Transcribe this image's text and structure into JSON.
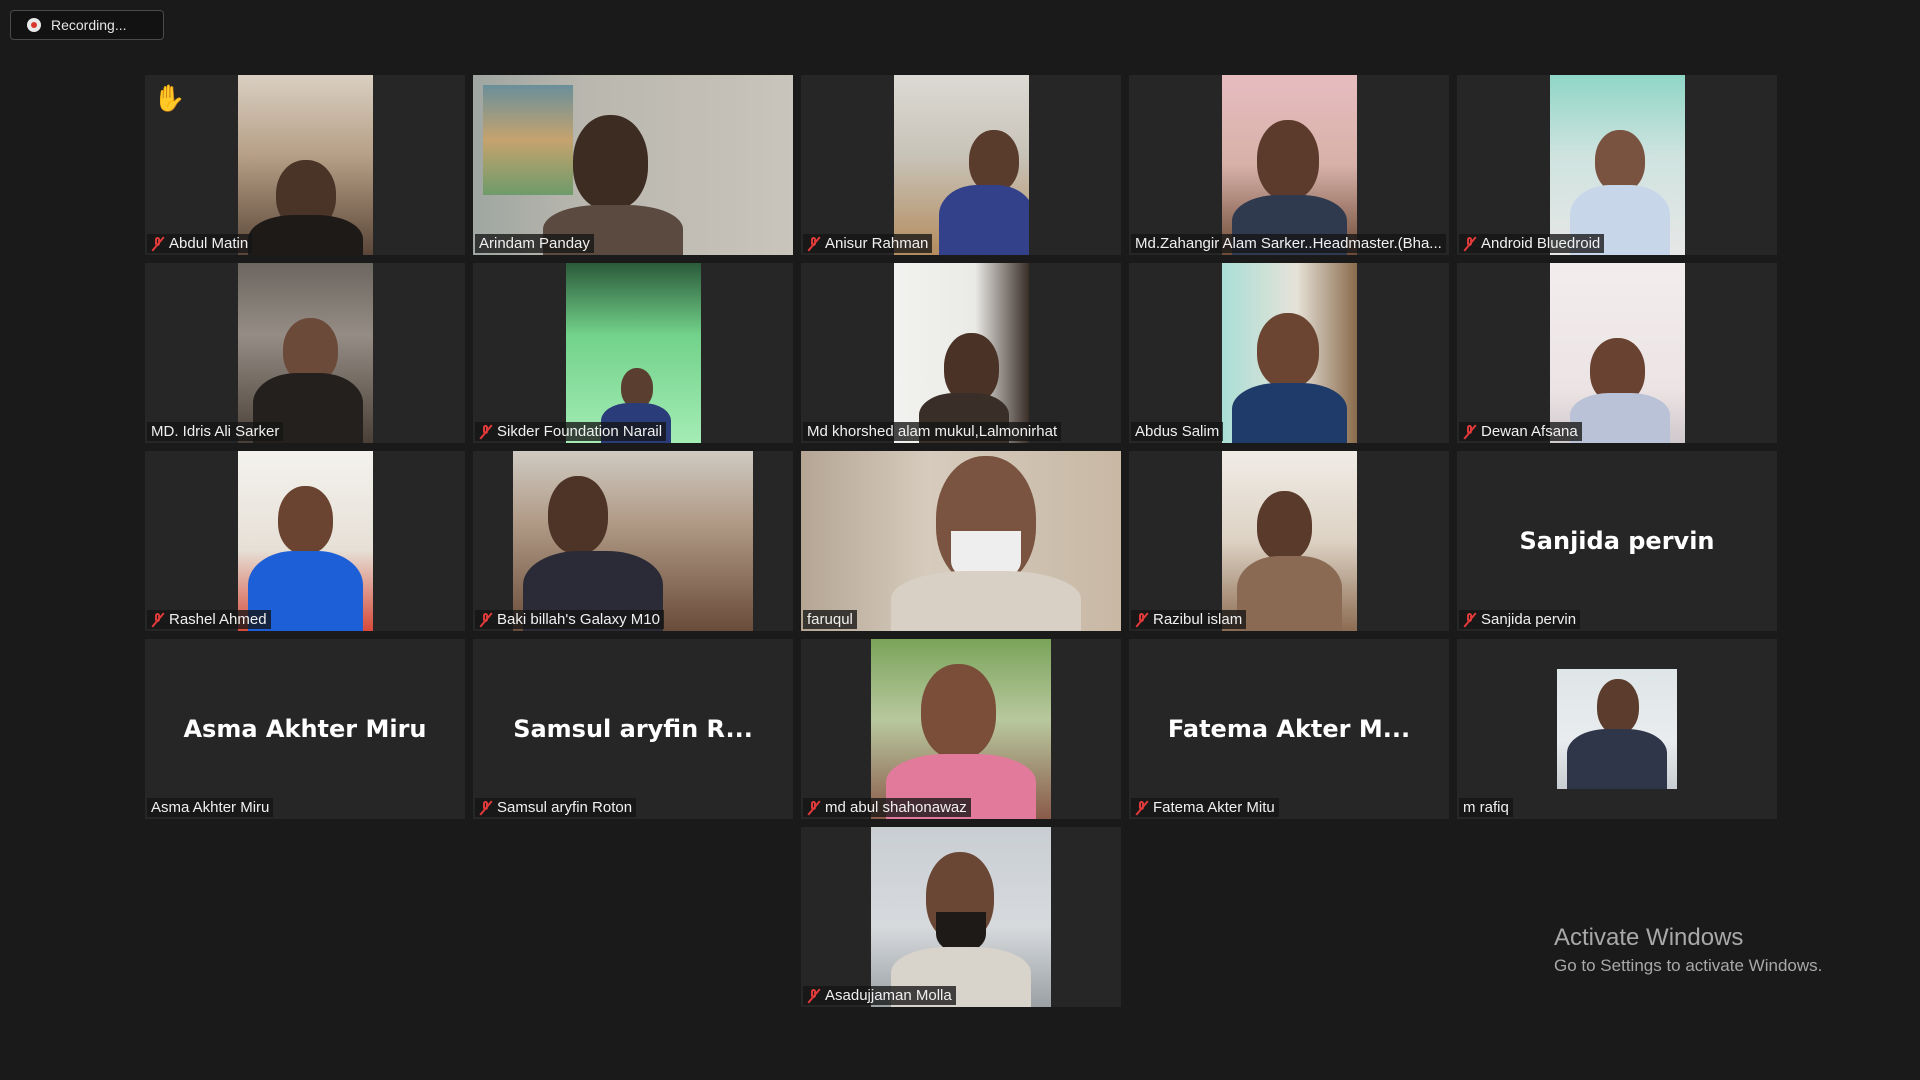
{
  "recording": {
    "label": "Recording..."
  },
  "participants": [
    {
      "name": "Abdul Matin",
      "muted": true,
      "hand_raised": true
    },
    {
      "name": "Arindam Panday",
      "muted": false,
      "active_speaker": true
    },
    {
      "name": "Anisur Rahman",
      "muted": true
    },
    {
      "name": "Md.Zahangir Alam Sarker..Headmaster.(Bha...",
      "muted": false
    },
    {
      "name": "Android Bluedroid",
      "muted": true
    },
    {
      "name": "MD. Idris Ali Sarker",
      "muted": false
    },
    {
      "name": "Sikder Foundation Narail",
      "muted": true
    },
    {
      "name": "Md khorshed alam mukul,Lalmonirhat",
      "muted": false
    },
    {
      "name": "Abdus Salim",
      "muted": false
    },
    {
      "name": "Dewan Afsana",
      "muted": true
    },
    {
      "name": "Rashel Ahmed",
      "muted": true
    },
    {
      "name": "Baki billah's Galaxy M10",
      "muted": true
    },
    {
      "name": "faruqul",
      "muted": false
    },
    {
      "name": "Razibul islam",
      "muted": true
    },
    {
      "name": "Sanjida pervin",
      "muted": true,
      "display_name": "Sanjida pervin"
    },
    {
      "name": "Asma Akhter Miru",
      "muted": false,
      "display_name": "Asma Akhter Miru"
    },
    {
      "name": "Samsul aryfin Roton",
      "muted": true,
      "display_name": "Samsul aryfin R..."
    },
    {
      "name": "md abul shahonawaz",
      "muted": true
    },
    {
      "name": "Fatema Akter Mitu",
      "muted": true,
      "display_name": "Fatema Akter M..."
    },
    {
      "name": "m rafiq",
      "muted": false
    },
    {
      "name": "Asadujjaman Molla",
      "muted": true
    }
  ],
  "watermark": {
    "title": "Activate Windows",
    "subtitle": "Go to Settings to activate Windows."
  },
  "colors": {
    "background": "#1a1a1a",
    "tile": "#262626",
    "active_speaker_border": "#c3de3a",
    "muted_icon": "#e03a3a"
  }
}
